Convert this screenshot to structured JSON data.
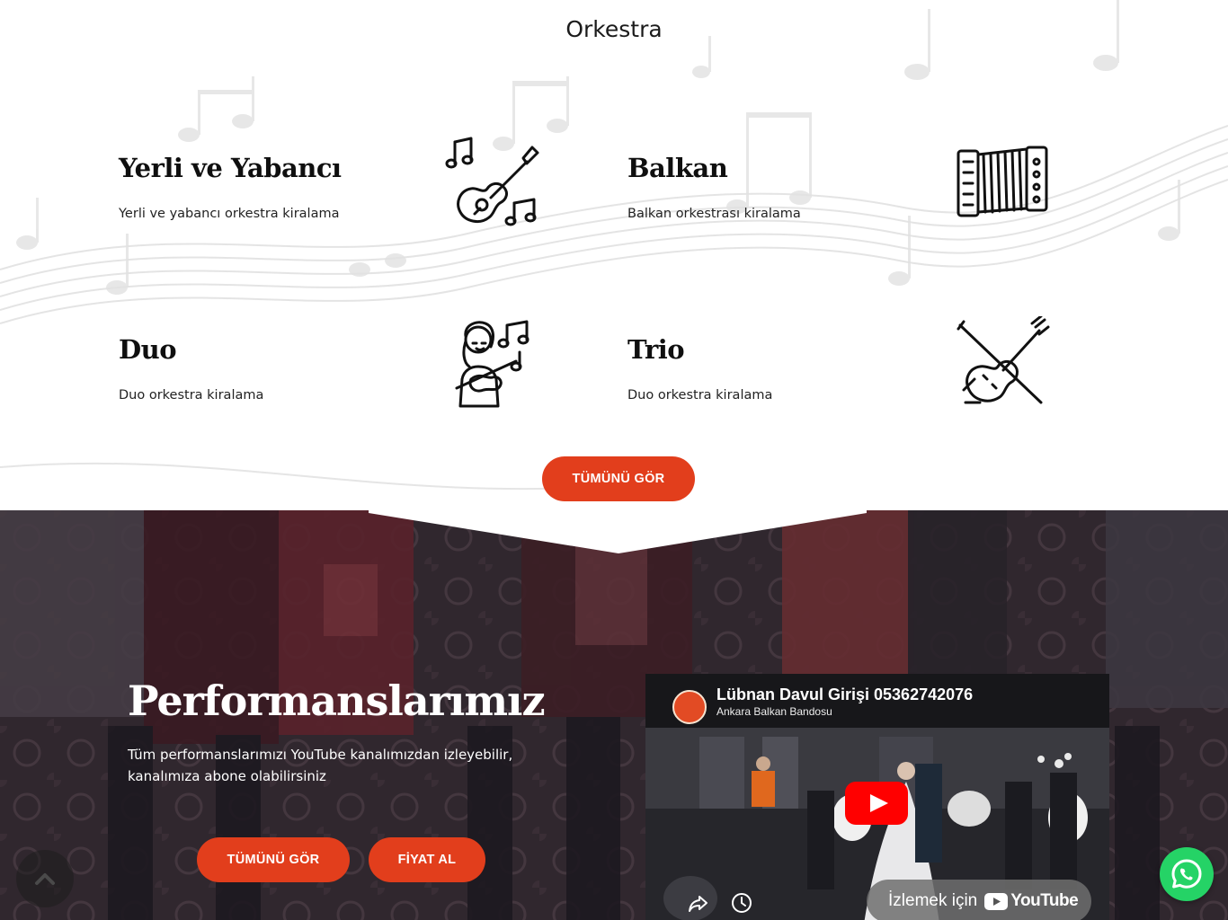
{
  "section": {
    "title": "Orkestra"
  },
  "cards": [
    {
      "title": "Yerli ve Yabancı",
      "desc": "Yerli ve yabancı orkestra kiralama",
      "icon": "guitar-icon"
    },
    {
      "title": "Balkan",
      "desc": "Balkan orkestrası kiralama",
      "icon": "accordion-icon"
    },
    {
      "title": "Duo",
      "desc": "Duo orkestra kiralama",
      "icon": "violinist-icon"
    },
    {
      "title": "Trio",
      "desc": "Duo orkestra kiralama",
      "icon": "violin-icon"
    }
  ],
  "buttons": {
    "view_all": "TÜMÜNÜ GÖR",
    "view_all_2": "TÜMÜNÜ GÖR",
    "get_price": "FİYAT AL"
  },
  "performances": {
    "title": "Performanslarımız",
    "description": "Tüm performanslarımızı YouTube kanalımızdan izleyebilir, kanalımıza abone olabilirsiniz"
  },
  "video": {
    "title": "Lübnan Davul Girişi 05362742076",
    "channel": "Ankara Balkan Bandosu",
    "watch_label": "İzlemek için",
    "youtube_label": "YouTube"
  },
  "colors": {
    "accent": "#e23e1c",
    "whatsapp": "#25d366",
    "youtube_red": "#ff0000"
  }
}
